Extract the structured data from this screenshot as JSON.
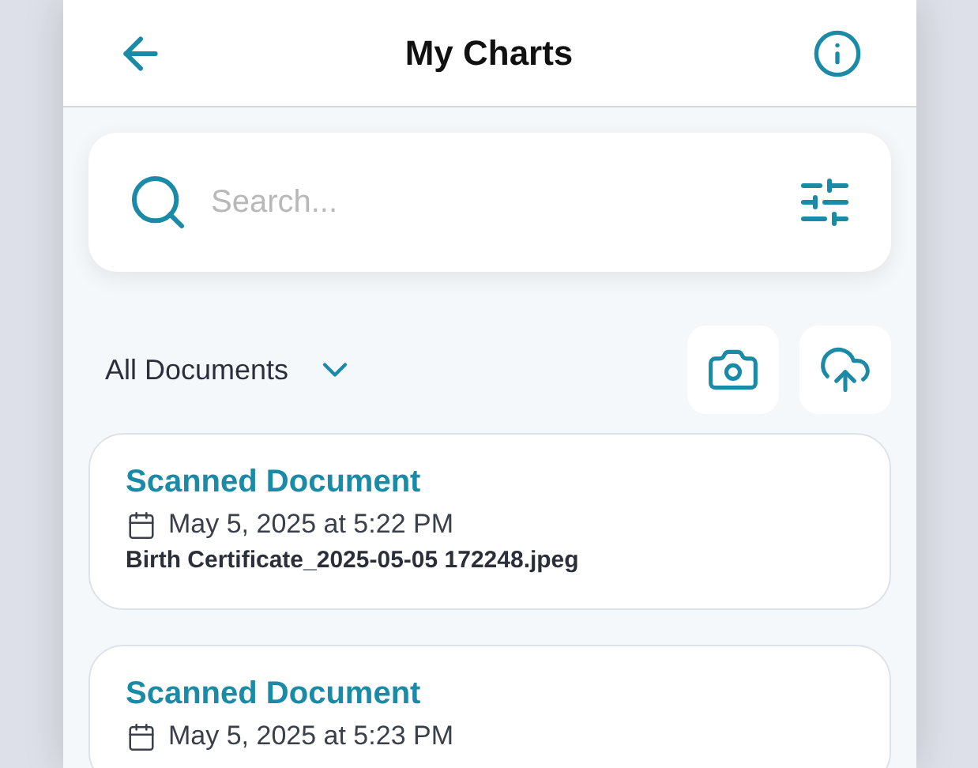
{
  "header": {
    "title": "My Charts"
  },
  "search": {
    "placeholder": "Search..."
  },
  "filter": {
    "label": "All Documents"
  },
  "documents": [
    {
      "title": "Scanned Document",
      "date": "May 5, 2025 at 5:22 PM",
      "filename": "Birth Certificate_2025-05-05 172248.jpeg"
    },
    {
      "title": "Scanned Document",
      "date": "May 5, 2025 at 5:23 PM"
    }
  ]
}
